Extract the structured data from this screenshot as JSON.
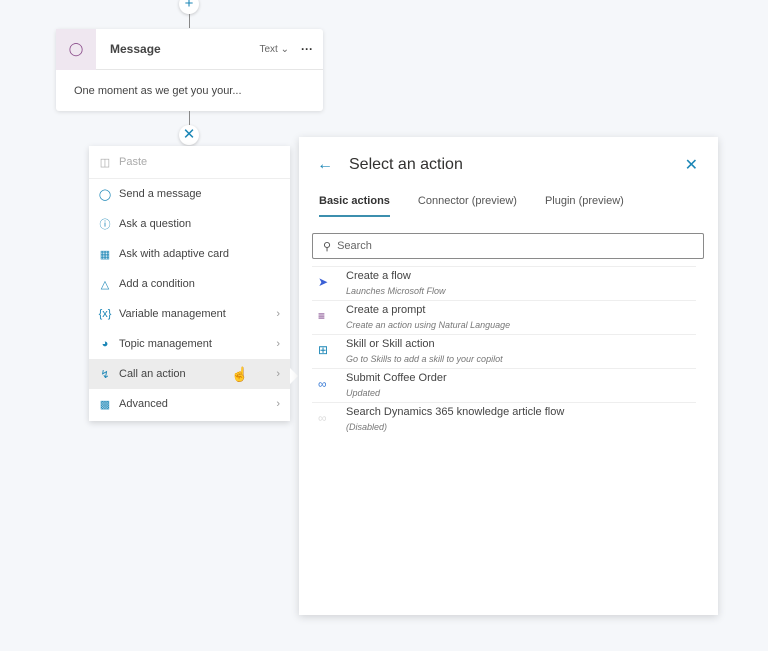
{
  "canvas": {
    "add_icon": "plus",
    "remove_icon": "close"
  },
  "message_node": {
    "title": "Message",
    "type": "Text",
    "more": "···",
    "body": "One moment as we get you your..."
  },
  "menu": {
    "items": [
      {
        "label": "Paste",
        "icon": "paste-icon",
        "disabled": true
      },
      {
        "label": "Send a message",
        "icon": "message-icon"
      },
      {
        "label": "Ask a question",
        "icon": "question-icon"
      },
      {
        "label": "Ask with adaptive card",
        "icon": "card-icon"
      },
      {
        "label": "Add a condition",
        "icon": "branch-icon"
      },
      {
        "label": "Variable management",
        "icon": "variable-icon",
        "submenu": true
      },
      {
        "label": "Topic management",
        "icon": "topic-icon",
        "submenu": true
      },
      {
        "label": "Call an action",
        "icon": "action-icon",
        "submenu": true,
        "hovered": true
      },
      {
        "label": "Advanced",
        "icon": "briefcase-icon",
        "submenu": true
      }
    ]
  },
  "panel": {
    "title": "Select an action",
    "tabs": [
      "Basic actions",
      "Connector (preview)",
      "Plugin (preview)"
    ],
    "active_tab": "Basic actions",
    "search_placeholder": "Search",
    "actions": [
      {
        "title": "Create a flow",
        "subtitle": "Launches Microsoft Flow",
        "icon": "flow-icon",
        "color": "#3a5fd5"
      },
      {
        "title": "Create a prompt",
        "subtitle": "Create an action using Natural Language",
        "icon": "prompt-icon",
        "color": "#6b2a7a"
      },
      {
        "title": "Skill or Skill action",
        "subtitle": "Go to Skills to add a skill to your copilot",
        "icon": "skill-icon",
        "color": "#1b86b6"
      },
      {
        "title": "Submit Coffee Order",
        "subtitle": "Updated",
        "icon": "connector-icon",
        "color": "#3a7bd5"
      },
      {
        "title": "Search Dynamics 365 knowledge article flow",
        "subtitle": "(Disabled)",
        "icon": "connector-icon",
        "color": "#dddddd"
      }
    ]
  }
}
